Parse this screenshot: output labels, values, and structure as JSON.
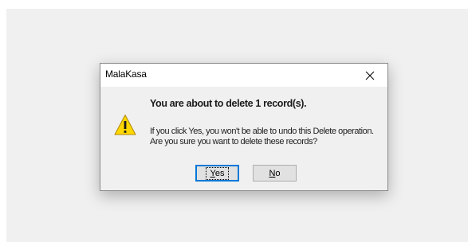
{
  "dialog": {
    "title": "MalaKasa",
    "close_glyph": "╳",
    "icon": "warning-icon",
    "heading": "You are about to delete 1 record(s).",
    "message_line1": "If you click Yes, you won't be able to undo this Delete operation.",
    "message_line2": "Are you sure you want to delete these records?",
    "buttons": {
      "yes": {
        "mnemonic": "Y",
        "rest": "es"
      },
      "no": {
        "mnemonic": "N",
        "rest": "o"
      }
    }
  },
  "colors": {
    "warning_fill": "#ffd700",
    "focus_border": "#0078d7",
    "dialog_background": "#f0f0f0"
  }
}
